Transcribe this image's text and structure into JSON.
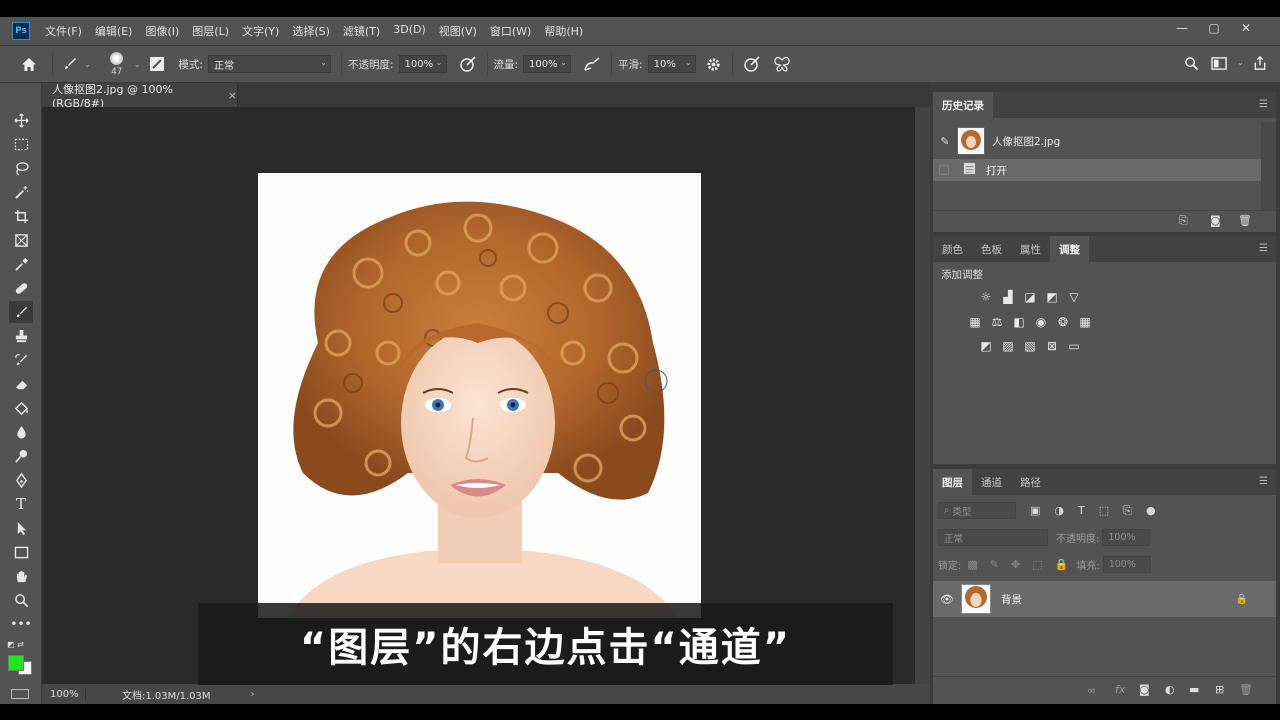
{
  "app": {
    "logo": "Ps"
  },
  "menu": [
    "文件(F)",
    "编辑(E)",
    "图像(I)",
    "图层(L)",
    "文字(Y)",
    "选择(S)",
    "滤镜(T)",
    "3D(D)",
    "视图(V)",
    "窗口(W)",
    "帮助(H)"
  ],
  "window_controls": {
    "minimize": "—",
    "restore": "▢",
    "close": "✕"
  },
  "options": {
    "brush_size": "47",
    "mode_label": "模式:",
    "mode_value": "正常",
    "opacity_label": "不透明度:",
    "opacity_value": "100%",
    "flow_label": "流量:",
    "flow_value": "100%",
    "smooth_label": "平滑:",
    "smooth_value": "10%"
  },
  "document": {
    "tab_title": "人像抠图2.jpg @ 100%(RGB/8#)",
    "tab_close": "×",
    "zoom": "100%",
    "doc_info": "文档:1.03M/1.03M",
    "status_arrow": "›"
  },
  "subtitle": "“图层”的右边点击“通道”",
  "history": {
    "tab": "历史记录",
    "items": [
      {
        "label": "人像抠图2.jpg"
      },
      {
        "label": "打开"
      }
    ]
  },
  "adjustments": {
    "tabs": [
      "颜色",
      "色板",
      "属性",
      "调整"
    ],
    "active_tab": 3,
    "add_label": "添加调整"
  },
  "layers": {
    "tabs": [
      "图层",
      "通道",
      "路径"
    ],
    "active_tab": 0,
    "filter_placeholder": "类型",
    "blend_mode": "正常",
    "opacity_label": "不透明度:",
    "opacity_value": "100%",
    "lock_label": "锁定:",
    "fill_label": "填充:",
    "fill_value": "100%",
    "layer_name": "背景"
  },
  "colors": {
    "foreground": "#22e41e",
    "background": "#ffffff",
    "chrome": "#535353",
    "canvas_bg": "#2a2a2a"
  }
}
